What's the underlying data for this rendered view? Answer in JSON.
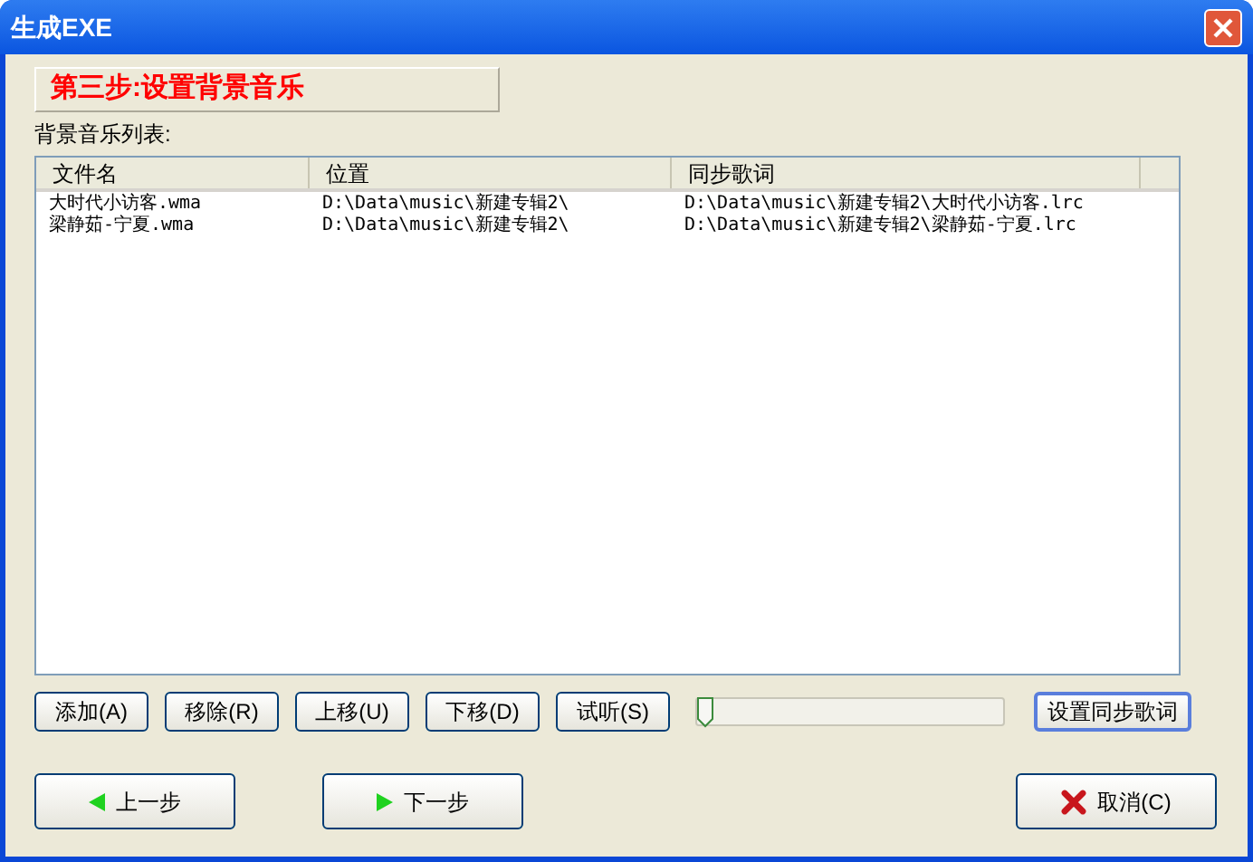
{
  "window": {
    "title": "生成EXE"
  },
  "step_title": "第三步:设置背景音乐",
  "list_label": "背景音乐列表:",
  "table": {
    "columns": [
      "文件名",
      "位置",
      "同步歌词"
    ],
    "rows": [
      [
        "大时代小访客.wma",
        "D:\\Data\\music\\新建专辑2\\",
        "D:\\Data\\music\\新建专辑2\\大时代小访客.lrc"
      ],
      [
        "梁静茹-宁夏.wma",
        "D:\\Data\\music\\新建专辑2\\",
        "D:\\Data\\music\\新建专辑2\\梁静茹-宁夏.lrc"
      ]
    ]
  },
  "list_buttons": [
    "添加(A)",
    "移除(R)",
    "上移(U)",
    "下移(D)",
    "试听(S)"
  ],
  "slider": {
    "level": 0
  },
  "lyrics_button": "设置同步歌词",
  "nav_buttons": [
    {
      "kind": "back",
      "label": "上一步"
    },
    {
      "kind": "next",
      "label": "下一步"
    },
    {
      "kind": "cancel",
      "label": "取消(C)"
    }
  ]
}
